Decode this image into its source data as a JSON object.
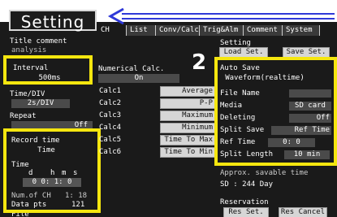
{
  "title": "Setting",
  "tabs": [
    "CH",
    "List",
    "Conv/Calc",
    "Trig&Alm",
    "Comment",
    "System"
  ],
  "left": {
    "title_comment_label": "Title comment",
    "title_comment_value": "analysis",
    "interval_label": "Interval",
    "interval_value": "500ms",
    "time_div_label": "Time/DIV",
    "time_div_value": "2s/DIV",
    "repeat_label": "Repeat",
    "repeat_value": "Off",
    "record_time_label": "Record time",
    "record_time_value": "Time",
    "time_label": "Time",
    "time_units": {
      "d": "d",
      "h": "h",
      "m": "m",
      "s": "s"
    },
    "time_value": "0  0: 1: 0",
    "num_ch_label": "Num.of CH",
    "num_ch_value": "1: 18",
    "data_pts_label": "Data pts",
    "data_pts_value": "121",
    "file_label": "File"
  },
  "calc": {
    "label": "Numerical Calc.",
    "value": "On",
    "rows": [
      {
        "name": "Calc1",
        "value": "Average"
      },
      {
        "name": "Calc2",
        "value": "P-P"
      },
      {
        "name": "Calc3",
        "value": "Maximum"
      },
      {
        "name": "Calc4",
        "value": "Minimum"
      },
      {
        "name": "Calc5",
        "value": "Time To Max"
      },
      {
        "name": "Calc6",
        "value": "Time To Min"
      }
    ]
  },
  "right": {
    "setting_label": "Setting",
    "load_set": "Load Set.",
    "save_set": "Save Set.",
    "auto_save_label": "Auto Save",
    "auto_save_value": "Waveform(realtime)",
    "file_name_label": "File Name",
    "media_label": "Media",
    "media_value": "SD card",
    "deleting_label": "Deleting",
    "deleting_value": "Off",
    "split_save_label": "Split Save",
    "split_save_value": "Ref Time",
    "ref_time_label": "Ref Time",
    "ref_time_value": "0: 0",
    "split_length_label": "Split Length",
    "split_length_value": "10 min",
    "approx_label": "Approx. savable time",
    "approx_value": "SD : 244 Day",
    "reservation_label": "Reservation",
    "res_set": "Res Set.",
    "res_cancel": "Res Cancel"
  },
  "callout_number": "2",
  "colors": {
    "highlight": "#f5e60f",
    "arrow": "#2f39d8",
    "panel": "#1a1a1a"
  }
}
